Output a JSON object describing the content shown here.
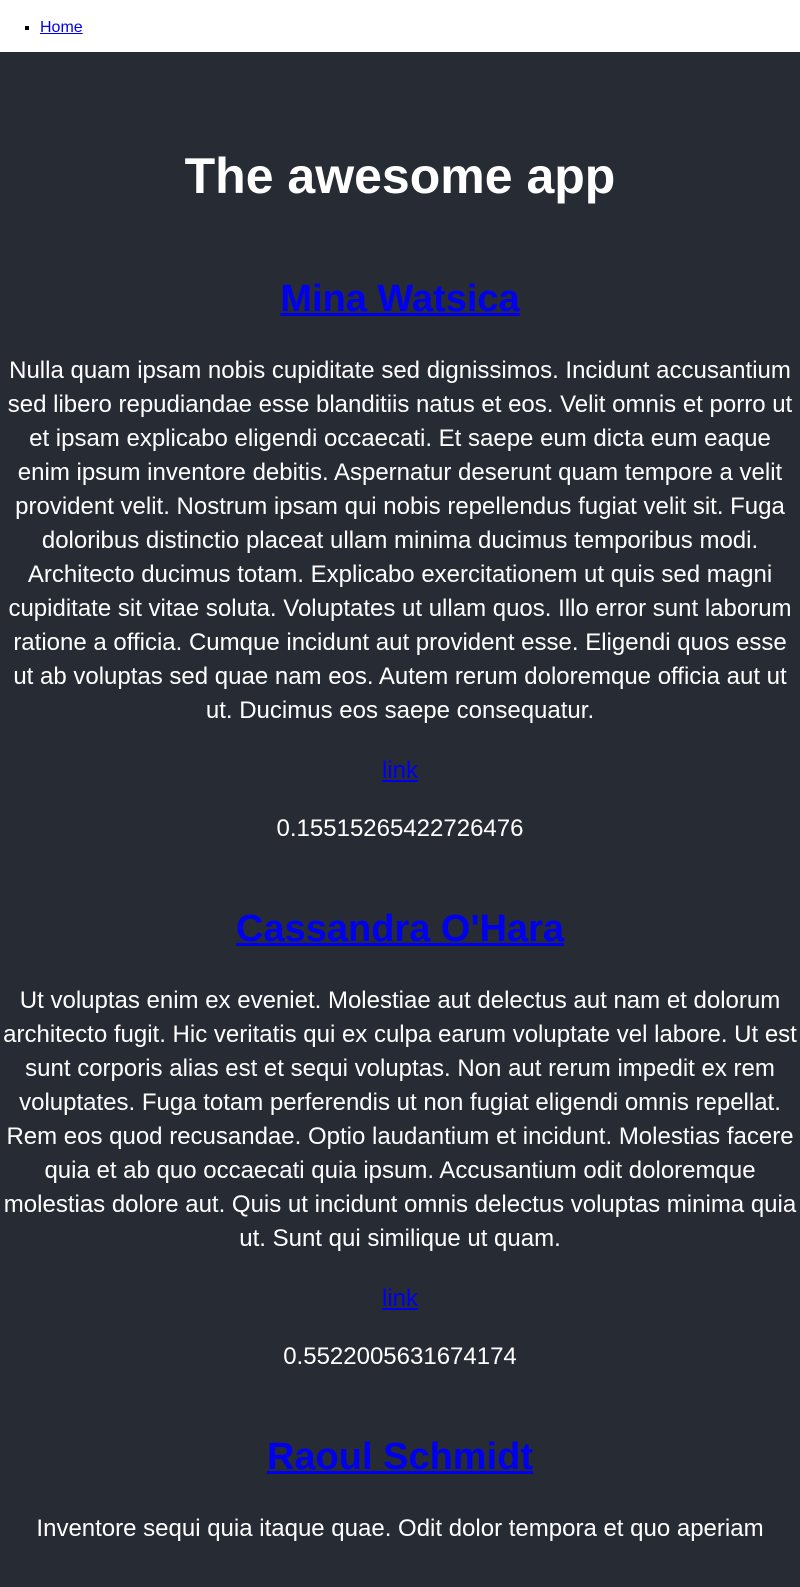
{
  "nav": {
    "items": [
      {
        "label": "Home"
      }
    ]
  },
  "app": {
    "title": "The awesome app"
  },
  "posts": [
    {
      "name": "Mina Watsica",
      "body": "Nulla quam ipsam nobis cupiditate sed dignissimos. Incidunt accusantium sed libero repudiandae esse blanditiis natus et eos. Velit omnis et porro ut et ipsam explicabo eligendi occaecati. Et saepe eum dicta eum eaque enim ipsum inventore debitis. Aspernatur deserunt quam tempore a velit provident velit. Nostrum ipsam qui nobis repellendus fugiat velit sit. Fuga doloribus distinctio placeat ullam minima ducimus temporibus modi. Architecto ducimus totam. Explicabo exercitationem ut quis sed magni cupiditate sit vitae soluta. Voluptates ut ullam quos. Illo error sunt laborum ratione a officia. Cumque incidunt aut provident esse. Eligendi quos esse ut ab voluptas sed quae nam eos. Autem rerum doloremque officia aut ut ut. Ducimus eos saepe consequatur.",
      "link_label": "link",
      "number": "0.15515265422726476"
    },
    {
      "name": "Cassandra O'Hara",
      "body": "Ut voluptas enim ex eveniet. Molestiae aut delectus aut nam et dolorum architecto fugit. Hic veritatis qui ex culpa earum voluptate vel labore. Ut est sunt corporis alias est et sequi voluptas. Non aut rerum impedit ex rem voluptates. Fuga totam perferendis ut non fugiat eligendi omnis repellat. Rem eos quod recusandae. Optio laudantium et incidunt. Molestias facere quia et ab quo occaecati quia ipsum. Accusantium odit doloremque molestias dolore aut. Quis ut incidunt omnis delectus voluptas minima quia ut. Sunt qui similique ut quam.",
      "link_label": "link",
      "number": "0.5522005631674174"
    },
    {
      "name": "Raoul Schmidt",
      "body": "Inventore sequi quia itaque quae. Odit dolor tempora et quo aperiam",
      "link_label": "",
      "number": ""
    }
  ]
}
